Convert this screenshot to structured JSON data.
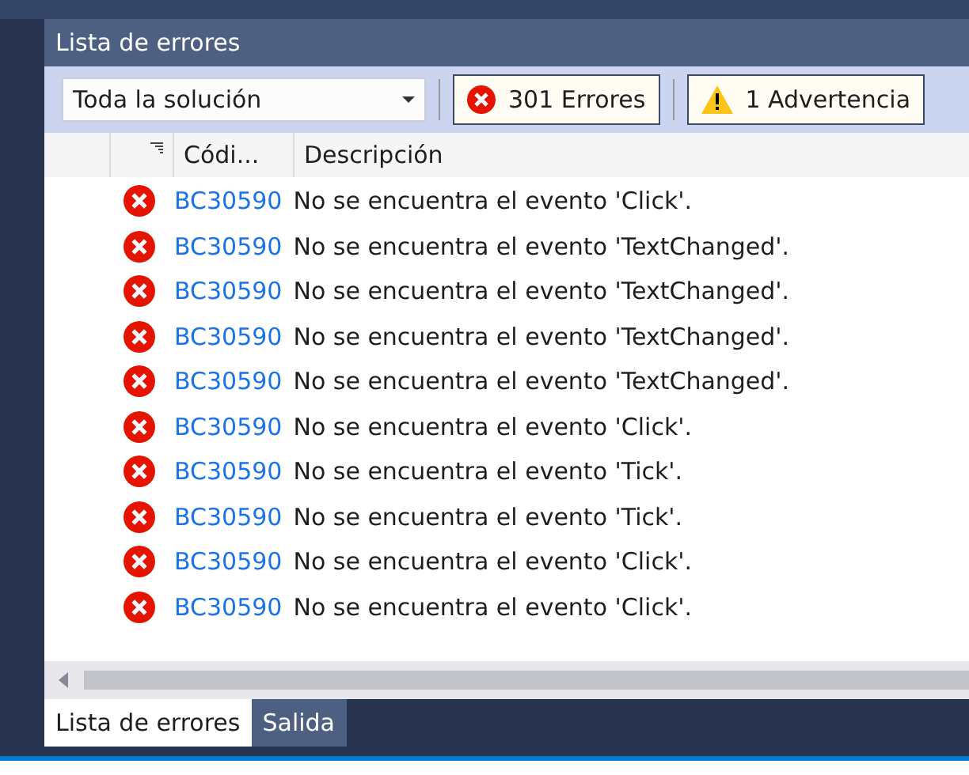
{
  "window": {
    "title": "Lista de errores"
  },
  "toolbar": {
    "scope": {
      "value": "Toda la solución"
    },
    "filters": [
      {
        "kind": "error",
        "label": "301 Errores",
        "selected": true
      },
      {
        "kind": "warning",
        "label": "1 Advertencia",
        "selected": true
      }
    ]
  },
  "table": {
    "columns": [
      "Códi...",
      "Descripción"
    ],
    "rows": [
      {
        "code": "BC30590",
        "description": "No se encuentra el evento 'Click'."
      },
      {
        "code": "BC30590",
        "description": "No se encuentra el evento 'TextChanged'."
      },
      {
        "code": "BC30590",
        "description": "No se encuentra el evento 'TextChanged'."
      },
      {
        "code": "BC30590",
        "description": "No se encuentra el evento 'TextChanged'."
      },
      {
        "code": "BC30590",
        "description": "No se encuentra el evento 'TextChanged'."
      },
      {
        "code": "BC30590",
        "description": "No se encuentra el evento 'Click'."
      },
      {
        "code": "BC30590",
        "description": "No se encuentra el evento 'Tick'."
      },
      {
        "code": "BC30590",
        "description": "No se encuentra el evento 'Tick'."
      },
      {
        "code": "BC30590",
        "description": "No se encuentra el evento 'Click'."
      },
      {
        "code": "BC30590",
        "description": "No se encuentra el evento 'Click'."
      }
    ]
  },
  "tabs": [
    {
      "label": "Lista de errores",
      "selected": true
    },
    {
      "label": "Salida",
      "selected": false
    }
  ]
}
